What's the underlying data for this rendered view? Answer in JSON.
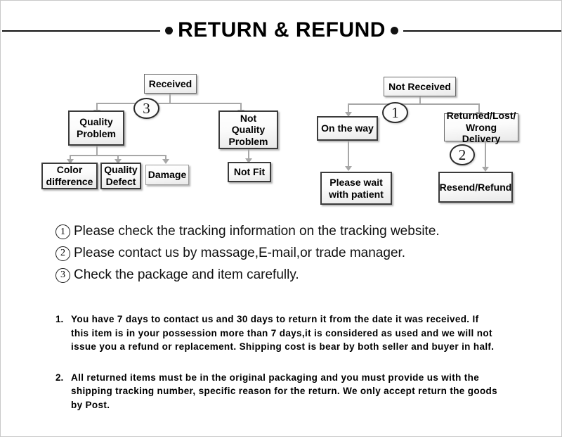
{
  "page": {
    "title": "RETURN & REFUND",
    "bullet_icon": "bullet-dot"
  },
  "flowchart": {
    "received_branch": {
      "root": "Received",
      "badge": "3",
      "left_child": "Quality\nProblem",
      "left_child_line1": "Quality",
      "left_child_line2": "Problem",
      "right_child_line1": "Not Quality",
      "right_child_line2": "Problem",
      "leaves": [
        {
          "line1": "Color",
          "line2": "difference"
        },
        {
          "line1": "Quality",
          "line2": "Defect"
        },
        {
          "line1": "Damage",
          "line2": ""
        }
      ],
      "right_leaf": "Not Fit"
    },
    "not_received_branch": {
      "root": "Not  Received",
      "badge_1": "1",
      "badge_2": "2",
      "left_child": "On the way",
      "left_leaf_line1": "Please wait",
      "left_leaf_line2": "with patient",
      "right_child_line1": "Returned/Lost/",
      "right_child_line2": "Wrong Delivery",
      "right_leaf": "Resend/Refund"
    }
  },
  "steps": [
    {
      "num": "1",
      "text": "Please check the tracking information on the tracking website."
    },
    {
      "num": "2",
      "text": "Please contact us by  massage,E-mail,or trade manager."
    },
    {
      "num": "3",
      "text": "Check the package and item carefully."
    }
  ],
  "policies": [
    {
      "num": "1.",
      "text": "You have 7 days to contact us and 30 days to return it from the date it was received. If this item is in your possession more than 7 days,it is considered as used and we will not issue you a refund or replacement. Shipping cost is bear by both seller and buyer in half."
    },
    {
      "num": "2.",
      "text": "All returned items must be in the original packaging and you must provide us with the shipping tracking number, specific reason for the return. We only accept return the goods by Post."
    }
  ],
  "colors": {
    "text": "#000000",
    "box_border": "#3b3b3b",
    "connector": "#a7a7a7",
    "background": "#ffffff"
  }
}
